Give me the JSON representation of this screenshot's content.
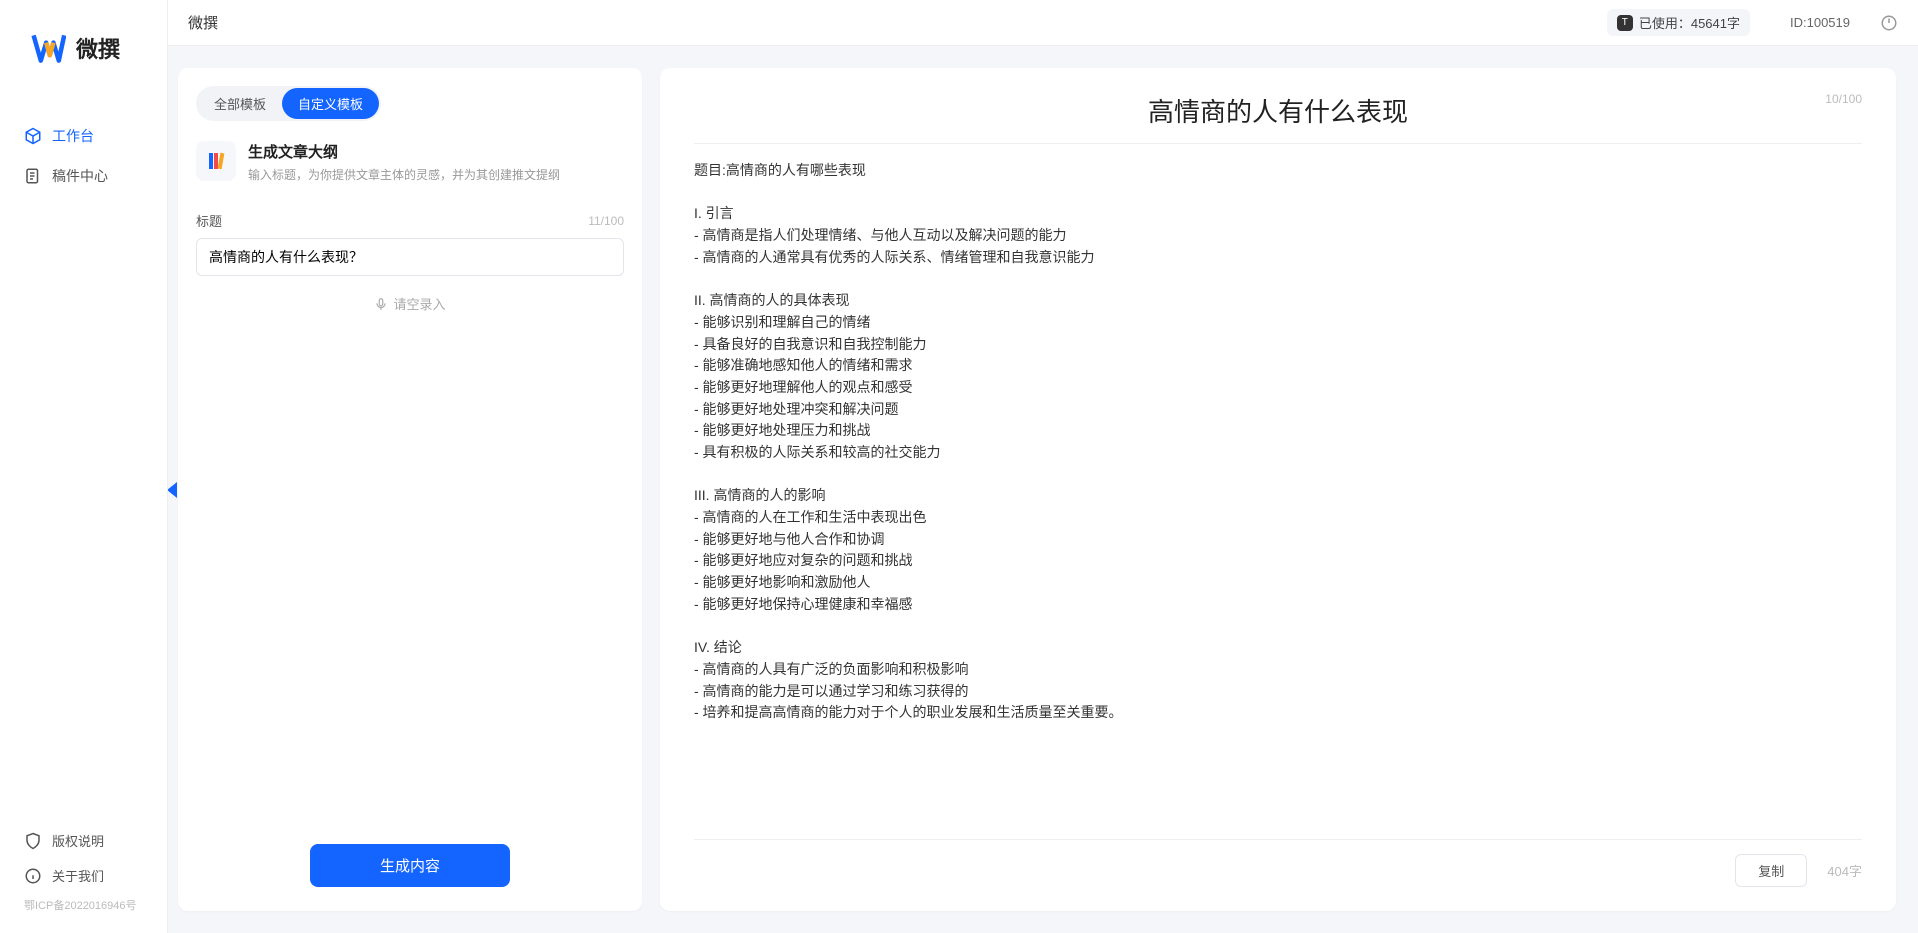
{
  "brand": {
    "name": "微撰"
  },
  "topbar": {
    "app_name": "微撰",
    "usage_label": "已使用：45641字",
    "id_label": "ID:100519"
  },
  "sidebar": {
    "nav": [
      {
        "label": "工作台",
        "active": true,
        "icon": "cube-icon"
      },
      {
        "label": "稿件中心",
        "active": false,
        "icon": "document-icon"
      }
    ],
    "bottom": [
      {
        "label": "版权说明",
        "icon": "shield-icon"
      },
      {
        "label": "关于我们",
        "icon": "info-icon"
      }
    ],
    "icp": "鄂ICP备2022016946号"
  },
  "left_panel": {
    "tabs": [
      {
        "label": "全部模板",
        "active": false
      },
      {
        "label": "自定义模板",
        "active": true
      }
    ],
    "template": {
      "title": "生成文章大纲",
      "desc": "输入标题，为你提供文章主体的灵感，并为其创建推文提纲"
    },
    "title_field": {
      "label": "标题",
      "value": "高情商的人有什么表现？",
      "counter": "11/100"
    },
    "voice_label": "请空录入",
    "generate_label": "生成内容"
  },
  "right_panel": {
    "title": "高情商的人有什么表现",
    "title_counter": "10/100",
    "body": "题目:高情商的人有哪些表现\n\nI. 引言\n- 高情商是指人们处理情绪、与他人互动以及解决问题的能力\n- 高情商的人通常具有优秀的人际关系、情绪管理和自我意识能力\n\nII. 高情商的人的具体表现\n- 能够识别和理解自己的情绪\n- 具备良好的自我意识和自我控制能力\n- 能够准确地感知他人的情绪和需求\n- 能够更好地理解他人的观点和感受\n- 能够更好地处理冲突和解决问题\n- 能够更好地处理压力和挑战\n- 具有积极的人际关系和较高的社交能力\n\nIII. 高情商的人的影响\n- 高情商的人在工作和生活中表现出色\n- 能够更好地与他人合作和协调\n- 能够更好地应对复杂的问题和挑战\n- 能够更好地影响和激励他人\n- 能够更好地保持心理健康和幸福感\n\nIV. 结论\n- 高情商的人具有广泛的负面影响和积极影响\n- 高情商的能力是可以通过学习和练习获得的\n- 培养和提高高情商的能力对于个人的职业发展和生活质量至关重要。",
    "copy_label": "复制",
    "word_count": "404字"
  }
}
